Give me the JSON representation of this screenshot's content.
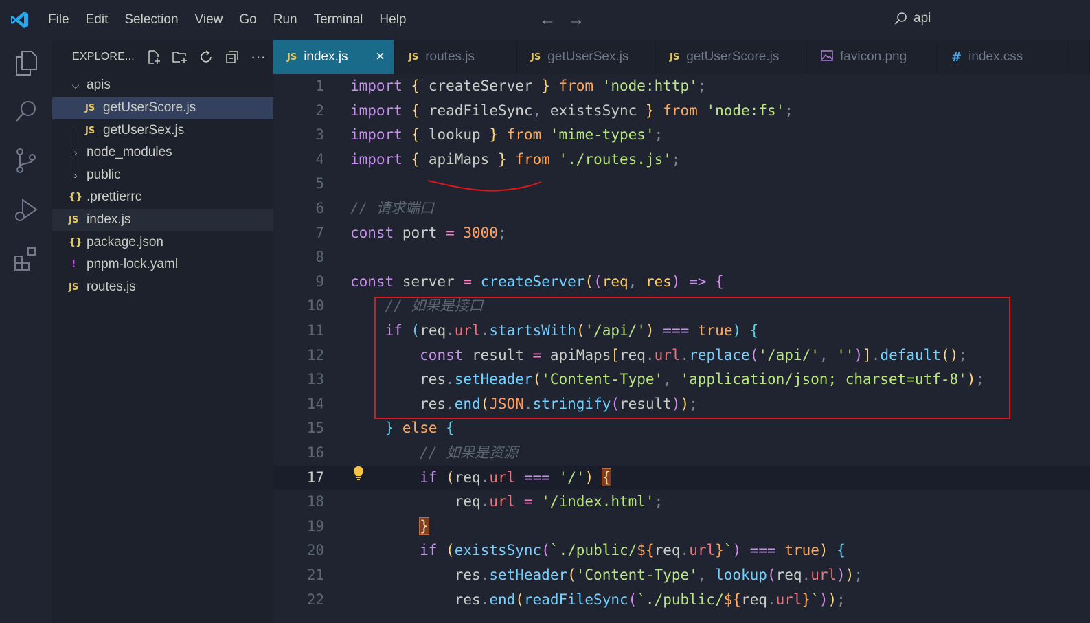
{
  "titlebar": {
    "menu": [
      "File",
      "Edit",
      "Selection",
      "View",
      "Go",
      "Run",
      "Terminal",
      "Help"
    ],
    "search_text": "api",
    "back_icon": "arrow-left-icon",
    "forward_icon": "arrow-right-icon"
  },
  "sidebar": {
    "title": "EXPLORE...",
    "tree": [
      {
        "label": "apis",
        "type": "folder-open",
        "depth": 0
      },
      {
        "label": "getUserScore.js",
        "type": "js",
        "depth": 1,
        "selected": true
      },
      {
        "label": "getUserSex.js",
        "type": "js",
        "depth": 1
      },
      {
        "label": "node_modules",
        "type": "folder-closed",
        "depth": 0
      },
      {
        "label": "public",
        "type": "folder-closed",
        "depth": 0
      },
      {
        "label": ".prettierrc",
        "type": "json",
        "depth": 0
      },
      {
        "label": "index.js",
        "type": "js",
        "depth": 0,
        "active": true
      },
      {
        "label": "package.json",
        "type": "json",
        "depth": 0
      },
      {
        "label": "pnpm-lock.yaml",
        "type": "yaml",
        "depth": 0
      },
      {
        "label": "routes.js",
        "type": "js",
        "depth": 0
      }
    ]
  },
  "tabs": [
    {
      "label": "index.js",
      "icon": "JS",
      "active": true
    },
    {
      "label": "routes.js",
      "icon": "JS"
    },
    {
      "label": "getUserSex.js",
      "icon": "JS"
    },
    {
      "label": "getUserScore.js",
      "icon": "JS"
    },
    {
      "label": "favicon.png",
      "icon": "image"
    },
    {
      "label": "index.css",
      "icon": "#"
    }
  ],
  "editor": {
    "current_line": 17,
    "line_numbers": [
      "1",
      "2",
      "3",
      "4",
      "5",
      "6",
      "7",
      "8",
      "9",
      "10",
      "11",
      "12",
      "13",
      "14",
      "15",
      "16",
      "17",
      "18",
      "19",
      "20",
      "21",
      "22"
    ]
  },
  "colors": {
    "background": "#1f2430",
    "sidebar": "#1c212b",
    "active_tab": "#1a6a8a",
    "annotation_red": "#e0161c",
    "accent_blue": "#23a9f2"
  }
}
